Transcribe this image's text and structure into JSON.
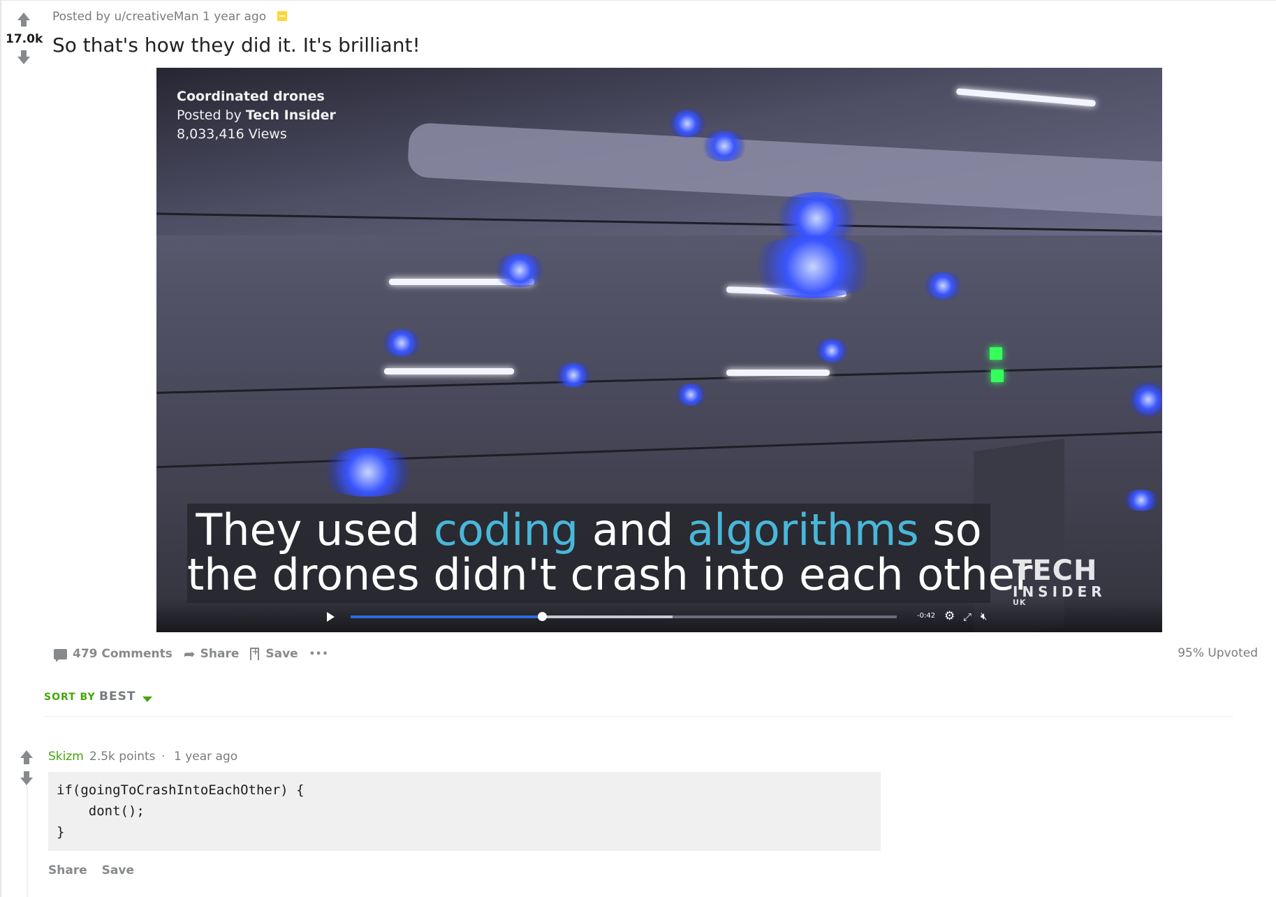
{
  "post": {
    "score": "17.0k",
    "meta_prefix": "Posted by",
    "author": "u/creativeMan",
    "age": "1 year ago",
    "title": "So that's how they did it. It's brilliant!"
  },
  "video": {
    "overlay_title": "Coordinated drones",
    "posted_by_label": "Posted by",
    "posted_by_name": "Tech Insider",
    "views": "8,033,416 Views",
    "caption_line1": [
      {
        "text": "They used ",
        "highlight": false
      },
      {
        "text": "coding",
        "highlight": true
      },
      {
        "text": " and ",
        "highlight": false
      },
      {
        "text": "algorithms",
        "highlight": true
      },
      {
        "text": " so",
        "highlight": false
      }
    ],
    "caption_line2": "the drones didn't crash into each other",
    "brand_line1": "TECH",
    "brand_line2": "INSIDER",
    "brand_line3": "UK",
    "time_remaining": "-0:42",
    "progress_fraction": 0.35,
    "buffered_fraction": 0.59,
    "highlight_color": "#49b7d8"
  },
  "actions": {
    "comments": "479 Comments",
    "share": "Share",
    "save": "Save",
    "more": "•••",
    "upvoted": "95% Upvoted"
  },
  "sort": {
    "label": "SORT BY",
    "value": "BEST"
  },
  "comment": {
    "author": "Skizm",
    "points": "2.5k points",
    "separator": "·",
    "age": "1 year ago",
    "code": "if(goingToCrashIntoEachOther) {\n    dont();\n}",
    "share": "Share",
    "save": "Save"
  },
  "colors": {
    "accent_green": "#46a508",
    "icon_gray": "#878a8c",
    "archive_yellow": "#ffd635",
    "video_progress": "#2d6cdf"
  }
}
